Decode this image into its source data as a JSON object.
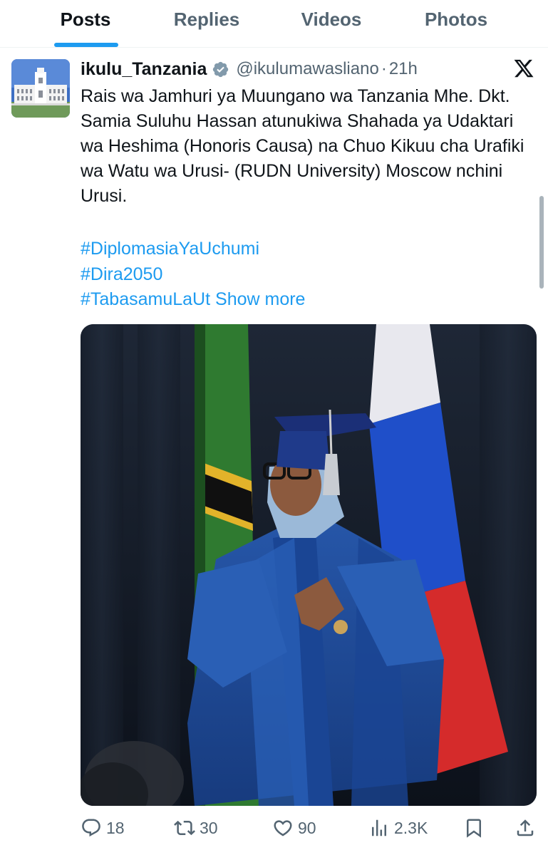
{
  "tabs": [
    {
      "label": "Posts",
      "active": true
    },
    {
      "label": "Replies",
      "active": false
    },
    {
      "label": "Videos",
      "active": false
    },
    {
      "label": "Photos",
      "active": false
    }
  ],
  "post": {
    "author_name": "ikulu_Tanzania",
    "author_handle": "@ikulumawasliano",
    "separator": "·",
    "time": "21h",
    "text": "Rais wa Jamhuri ya Muungano wa Tanzania  Mhe. Dkt. Samia Suluhu Hassan atunukiwa Shahada ya Udaktari wa Heshima (Honoris Causa) na Chuo Kikuu cha Urafiki wa Watu wa Urusi- (RUDN University) Moscow nchini Urusi.",
    "hashtags": [
      "#DiplomasiaYaUchumi",
      "#Dira2050",
      "#TabasamuLaUt"
    ],
    "show_more": "Show more",
    "icons": {
      "verified": "verified-badge-icon",
      "x_logo": "x-logo-icon"
    }
  },
  "actions": {
    "replies": "18",
    "reposts": "30",
    "likes": "90",
    "views": "2.3K"
  },
  "colors": {
    "accent": "#1d9bf0",
    "text": "#0f1419",
    "muted": "#536471"
  }
}
